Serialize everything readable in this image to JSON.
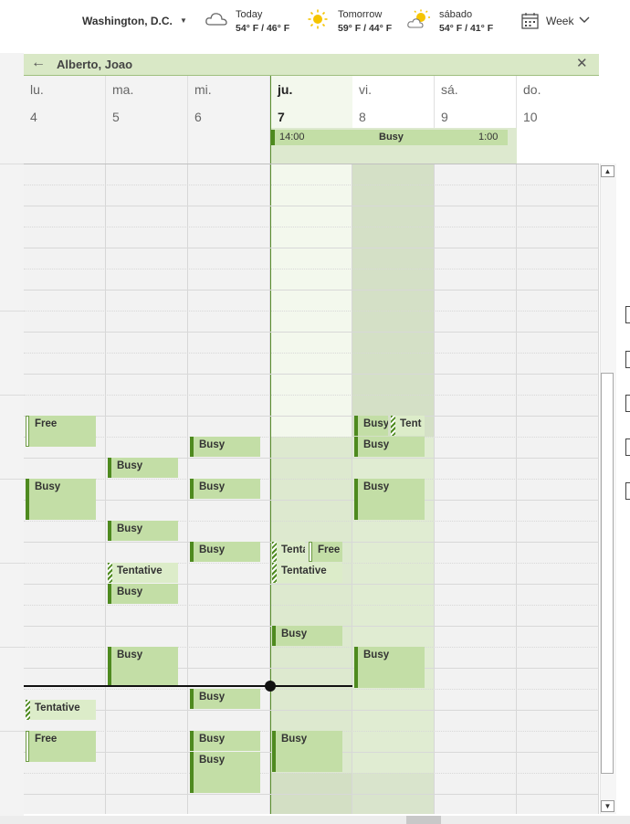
{
  "topbar": {
    "location": "Washington,  D.C.",
    "weather": [
      {
        "label": "Today",
        "temp": "54° F / 46° F",
        "icon": "cloud-icon"
      },
      {
        "label": "Tomorrow",
        "temp": "59° F / 44° F",
        "icon": "sun-icon"
      },
      {
        "label": "sábado",
        "temp": "54° F / 41° F",
        "icon": "partly-sunny-icon"
      }
    ],
    "view_label": "Week"
  },
  "panel": {
    "title": "Alberto, Joao",
    "days": [
      {
        "name": "lu.",
        "num": "4"
      },
      {
        "name": "ma.",
        "num": "5"
      },
      {
        "name": "mi.",
        "num": "6"
      },
      {
        "name": "ju.",
        "num": "7"
      },
      {
        "name": "vi.",
        "num": "8"
      },
      {
        "name": "sá.",
        "num": "9"
      },
      {
        "name": "do.",
        "num": "10"
      }
    ],
    "allday_event": {
      "start": "14:00",
      "label": "Busy",
      "end": "1:00"
    }
  },
  "events": [
    {
      "label": "Free"
    },
    {
      "label": "Busy"
    },
    {
      "label": "Tentative"
    },
    {
      "label": "Free"
    },
    {
      "label": "Busy"
    },
    {
      "label": "Busy"
    },
    {
      "label": "Tentative"
    },
    {
      "label": "Busy"
    },
    {
      "label": "Busy"
    },
    {
      "label": "Busy"
    },
    {
      "label": "Busy"
    },
    {
      "label": "Busy"
    },
    {
      "label": "Busy"
    },
    {
      "label": "Busy"
    },
    {
      "label": "Busy"
    },
    {
      "label": "Tenta"
    },
    {
      "label": "Free"
    },
    {
      "label": "Tentative"
    },
    {
      "label": "Busy"
    },
    {
      "label": "Busy"
    },
    {
      "label": "Busy"
    },
    {
      "label": "Tent"
    },
    {
      "label": "Busy"
    },
    {
      "label": "Busy"
    },
    {
      "label": "Busy"
    }
  ],
  "colors": {
    "busy": "#c3dea6",
    "busy_bar": "#4e8a1f",
    "header_green": "#d9e8c6",
    "today_column": "#dde9cf"
  }
}
